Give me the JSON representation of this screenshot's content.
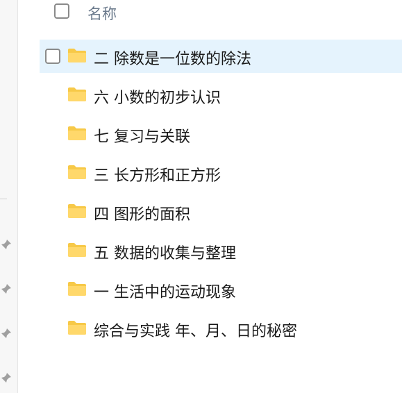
{
  "header": {
    "column_name": "名称"
  },
  "items": [
    {
      "label": "二 除数是一位数的除法",
      "selected": true
    },
    {
      "label": "六 小数的初步认识"
    },
    {
      "label": "七 复习与关联"
    },
    {
      "label": "三 长方形和正方形"
    },
    {
      "label": "四 图形的面积"
    },
    {
      "label": "五 数据的收集与整理"
    },
    {
      "label": "一 生活中的运动现象"
    },
    {
      "label": "综合与实践 年、月、日的秘密"
    }
  ],
  "icons": {
    "item_icon": "folder-icon",
    "rail_icon": "pin-icon"
  },
  "colors": {
    "selection": "#e5f3fd",
    "folder": "#f7c948"
  }
}
